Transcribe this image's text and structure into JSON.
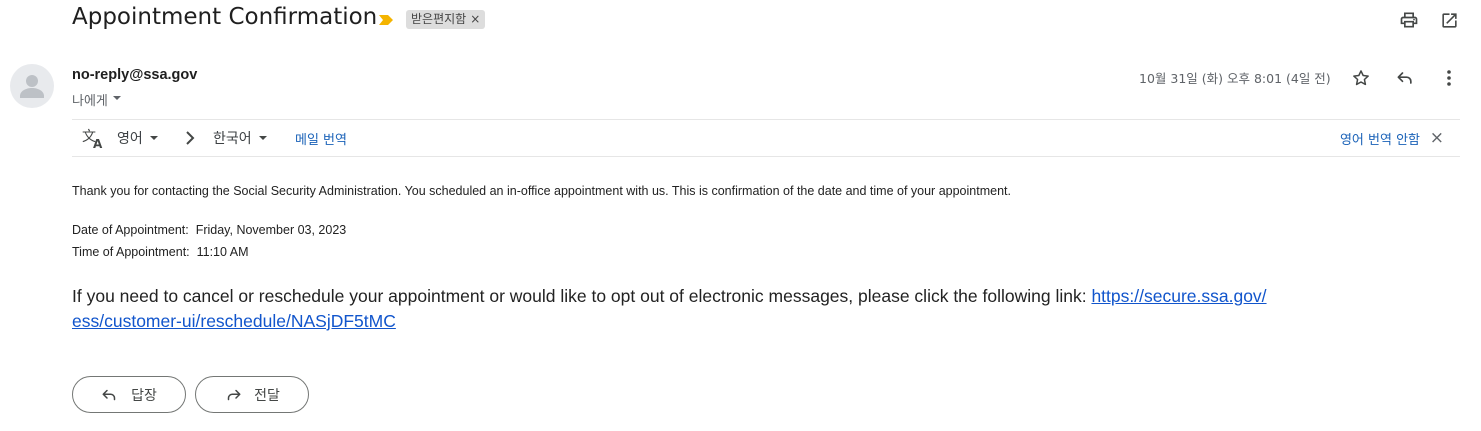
{
  "email": {
    "subject": "Appointment Confirmation",
    "label": "받은편지함",
    "label_remove": "×",
    "sender": "no-reply@ssa.gov",
    "recipient": "나에게",
    "date": "10월 31일 (화) 오후 8:01 (4일 전)"
  },
  "translate": {
    "source_lang": "영어",
    "target_lang": "한국어",
    "translate_link": "메일 번역",
    "never_translate": "영어 번역 안함",
    "close": "×"
  },
  "message": {
    "intro": "Thank you for contacting the Social Security Administration.  You scheduled an in-office appointment with us.  This is confirmation of the date and time of your appointment.",
    "date_label": "Date of Appointment:",
    "date_value": "Friday, November 03, 2023",
    "time_label": "Time of Appointment:",
    "time_value": "11:10 AM",
    "cancel_text": "If you need to cancel or reschedule your appointment or would like to opt out of electronic messages, please click the following link: ",
    "link_line1": "https://secure.ssa.gov/",
    "link_line2": "ess/customer-ui/reschedule/NASjDF5tMC"
  },
  "actions": {
    "reply": "답장",
    "forward": "전달"
  },
  "icons": {
    "print": "print-icon",
    "open_new_window": "open-in-new-window-icon",
    "star": "star-icon",
    "reply": "reply-icon",
    "more": "more-vert-icon",
    "translate": "translate-icon",
    "important": "importance-marker-icon"
  },
  "colors": {
    "link": "#1155cc",
    "translate_link": "#1a62b8",
    "important_marker": "#f4b400",
    "label_chip": "#dddddd"
  }
}
